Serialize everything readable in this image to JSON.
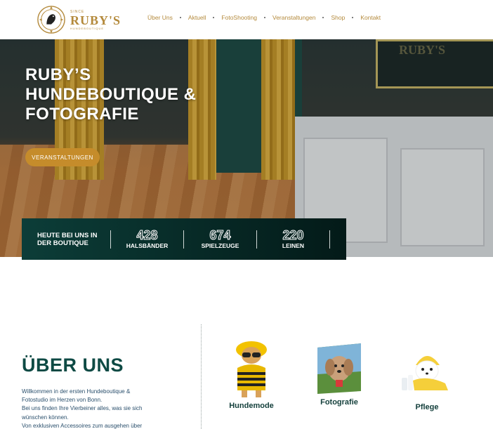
{
  "header": {
    "logo": {
      "small_text": "SINCE",
      "name": "RUBY'S",
      "tagline": "HUNDEBOUTIQUE"
    },
    "nav": [
      {
        "label": "Über Uns"
      },
      {
        "label": "Aktuell"
      },
      {
        "label": "FotoShooting"
      },
      {
        "label": "Veranstaltungen"
      },
      {
        "label": "Shop"
      },
      {
        "label": "Kontakt"
      }
    ]
  },
  "hero": {
    "sign_text": "RUBY'S",
    "title": "RUBY’S HUNDEBOUTIQUE & FOTOGRAFIE",
    "button_label": "VERANSTALTUNGEN"
  },
  "stats": {
    "heading": "HEUTE BEI UNS IN DER BOUTIQUE",
    "items": [
      {
        "value": "428",
        "label": "HALSBÄNDER"
      },
      {
        "value": "674",
        "label": "SPIELZEUGE"
      },
      {
        "value": "220",
        "label": "LEINEN"
      }
    ]
  },
  "about": {
    "title": "ÜBER UNS",
    "lines": [
      "Willkommen in der ersten Hundeboutique &",
      "Fotostudio im Herzen von Bonn.",
      "Bei uns finden Ihre Vierbeiner alles, was sie sich",
      "wünschen können.",
      "Von exklusiven Accessoires zum ausgehen über"
    ]
  },
  "features": [
    {
      "label": "Hundemode"
    },
    {
      "label": "Fotografie"
    },
    {
      "label": "Pflege"
    }
  ],
  "colors": {
    "gold": "#c58c2b",
    "teal_dark": "#0e4a44",
    "stats_bg": "#031a18"
  }
}
